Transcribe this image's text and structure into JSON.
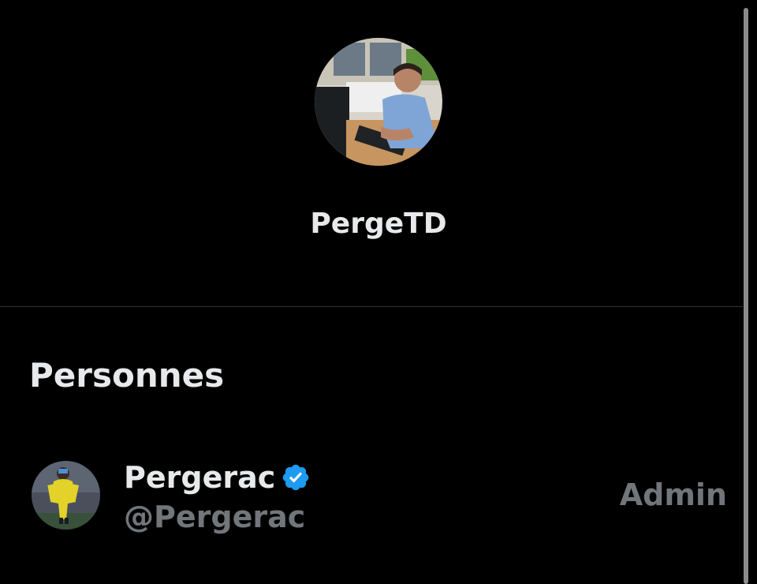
{
  "group": {
    "name": "PergeTD",
    "avatar": "group-photo-avatar"
  },
  "people": {
    "title": "Personnes",
    "members": [
      {
        "name": "Pergerac",
        "handle": "@Pergerac",
        "verified": true,
        "role": "Admin",
        "avatar": "member-photo-avatar"
      }
    ]
  },
  "colors": {
    "background": "#000000",
    "primary_text": "#e7e9ea",
    "secondary_text": "#71767b",
    "verified_badge": "#1d9bf0",
    "divider": "#2f3336"
  }
}
